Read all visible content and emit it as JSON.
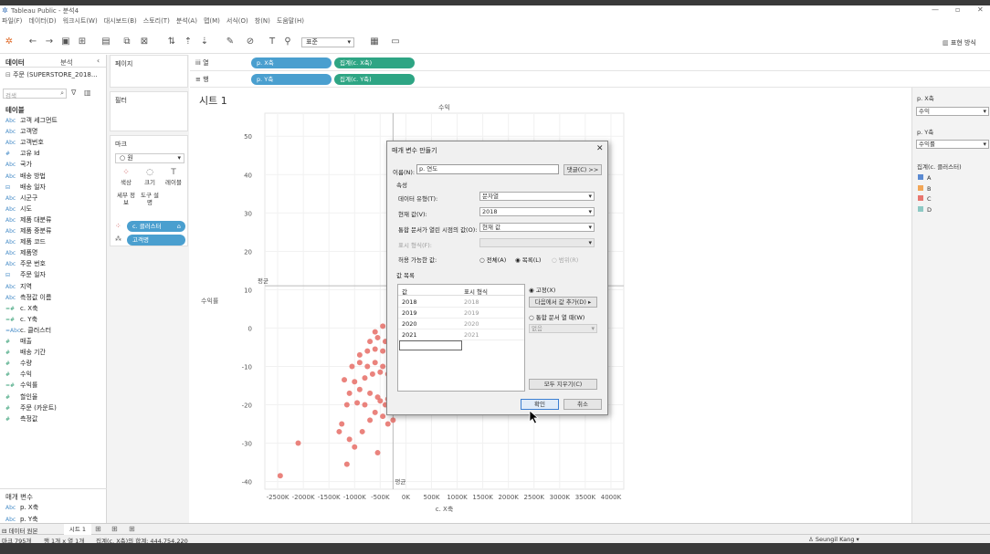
{
  "window": {
    "title": "Tableau Public - 분석4"
  },
  "menu": [
    "파일(F)",
    "데이터(D)",
    "워크시트(W)",
    "대시보드(B)",
    "스토리(T)",
    "분석(A)",
    "맵(M)",
    "서식(O)",
    "창(N)",
    "도움말(H)"
  ],
  "toolbar": {
    "fit_select": "표준",
    "show_me": "표현 방식"
  },
  "data_pane": {
    "tab_data": "데이터",
    "tab_analysis": "분석",
    "datasource": "주문 (SUPERSTORE_2018...",
    "search_placeholder": "검색",
    "tables_header": "테이블",
    "fields": [
      {
        "type": "Abc",
        "name": "고객 세그먼트",
        "kind": "d"
      },
      {
        "type": "Abc",
        "name": "고객명",
        "kind": "d"
      },
      {
        "type": "Abc",
        "name": "고객번호",
        "kind": "d"
      },
      {
        "type": "#",
        "name": "고유 Id",
        "kind": "d"
      },
      {
        "type": "Abc",
        "name": "국가",
        "kind": "d"
      },
      {
        "type": "Abc",
        "name": "배송 방법",
        "kind": "d"
      },
      {
        "type": "⊟",
        "name": "배송 일자",
        "kind": "d"
      },
      {
        "type": "Abc",
        "name": "시군구",
        "kind": "d"
      },
      {
        "type": "Abc",
        "name": "시도",
        "kind": "d"
      },
      {
        "type": "Abc",
        "name": "제품 대분류",
        "kind": "d"
      },
      {
        "type": "Abc",
        "name": "제품 중분류",
        "kind": "d"
      },
      {
        "type": "Abc",
        "name": "제품 코드",
        "kind": "d"
      },
      {
        "type": "Abc",
        "name": "제품명",
        "kind": "d"
      },
      {
        "type": "Abc",
        "name": "주문 번호",
        "kind": "d"
      },
      {
        "type": "⊟",
        "name": "주문 일자",
        "kind": "d"
      },
      {
        "type": "Abc",
        "name": "지역",
        "kind": "d"
      },
      {
        "type": "Abc",
        "name": "측정값 이름",
        "kind": "d"
      },
      {
        "type": "=#",
        "name": "c. X축",
        "kind": "g"
      },
      {
        "type": "=#",
        "name": "c. Y축",
        "kind": "g"
      },
      {
        "type": "=Abc",
        "name": "c. 클러스터",
        "kind": "d"
      },
      {
        "type": "#",
        "name": "매출",
        "kind": "g"
      },
      {
        "type": "#",
        "name": "배송 기간",
        "kind": "g"
      },
      {
        "type": "#",
        "name": "수량",
        "kind": "g"
      },
      {
        "type": "#",
        "name": "수익",
        "kind": "g"
      },
      {
        "type": "=#",
        "name": "수익률",
        "kind": "g"
      },
      {
        "type": "#",
        "name": "할인율",
        "kind": "g"
      },
      {
        "type": "#",
        "name": "주문 (카운트)",
        "kind": "g"
      },
      {
        "type": "#",
        "name": "측정값",
        "kind": "g"
      }
    ],
    "params_header": "매개 변수",
    "params": [
      {
        "type": "Abc",
        "name": "p. X축"
      },
      {
        "type": "Abc",
        "name": "p. Y축"
      }
    ]
  },
  "shelves": {
    "pages": "페이지",
    "filters": "필터",
    "marks": "마크",
    "mark_type": "원",
    "mark_buttons": [
      "색상",
      "크기",
      "레이블",
      "세부 정보",
      "도구 설명"
    ],
    "mark_pills": [
      "c. 클러스터",
      "고객명"
    ],
    "columns_label": "열",
    "rows_label": "행",
    "columns_pills": [
      "p. X축",
      "집계(c. X축)"
    ],
    "rows_pills": [
      "p. Y축",
      "집계(c. Y축)"
    ]
  },
  "sheet": {
    "title": "시트 1",
    "top_axis_title": "수익",
    "ylabel": "수익률",
    "xlabel": "c. X축",
    "avg_label_y": "평균",
    "avg_label_x": "평균"
  },
  "chart_data": {
    "type": "scatter",
    "xlabel": "c. X축",
    "ylabel": "수익률",
    "xlim": [
      -2750,
      4250
    ],
    "ylim": [
      -42,
      56
    ],
    "xticks": [
      "-2500K",
      "-2000K",
      "-1500K",
      "-1000K",
      "-500K",
      "0K",
      "500K",
      "1000K",
      "1500K",
      "2000K",
      "2500K",
      "3000K",
      "3500K",
      "4000K"
    ],
    "xtick_values": [
      -2500,
      -2000,
      -1500,
      -1000,
      -500,
      0,
      500,
      1000,
      1500,
      2000,
      2500,
      3000,
      3500,
      4000
    ],
    "yticks": [
      50,
      40,
      30,
      20,
      10,
      0,
      -10,
      -20,
      -30,
      -40
    ],
    "reference_lines": {
      "y_avg": 11,
      "x_avg": -250
    },
    "marker_color": "#e8766f",
    "points": [
      [
        -2450,
        -38.5
      ],
      [
        -2100,
        -30
      ],
      [
        -1150,
        -35.5
      ],
      [
        -1300,
        -27
      ],
      [
        -1100,
        -29
      ],
      [
        -1250,
        -25
      ],
      [
        -1000,
        -31
      ],
      [
        -850,
        -27
      ],
      [
        -550,
        -32.5
      ],
      [
        -700,
        -24
      ],
      [
        -600,
        -22
      ],
      [
        -450,
        -23
      ],
      [
        -350,
        -25
      ],
      [
        -250,
        -24
      ],
      [
        -400,
        -20
      ],
      [
        -500,
        -19
      ],
      [
        -800,
        -20
      ],
      [
        -950,
        -19.5
      ],
      [
        -1150,
        -20
      ],
      [
        -1100,
        -17
      ],
      [
        -900,
        -16
      ],
      [
        -700,
        -17
      ],
      [
        -550,
        -18
      ],
      [
        -350,
        -18.5
      ],
      [
        -1200,
        -13.5
      ],
      [
        -1000,
        -14
      ],
      [
        -800,
        -13
      ],
      [
        -650,
        -12
      ],
      [
        -500,
        -11.5
      ],
      [
        -350,
        -12
      ],
      [
        -1050,
        -10
      ],
      [
        -900,
        -9
      ],
      [
        -750,
        -10
      ],
      [
        -600,
        -9
      ],
      [
        -450,
        -10
      ],
      [
        -300,
        -11
      ],
      [
        -900,
        -7
      ],
      [
        -750,
        -6
      ],
      [
        -600,
        -5.5
      ],
      [
        -450,
        -6
      ],
      [
        -300,
        -7.5
      ],
      [
        -700,
        -3.5
      ],
      [
        -550,
        -2.5
      ],
      [
        -400,
        -3.5
      ],
      [
        -600,
        -1
      ],
      [
        -450,
        0.5
      ],
      [
        -300,
        -1
      ]
    ]
  },
  "right_panel": {
    "p_x_label": "p. X축",
    "p_x_value": "수익",
    "p_y_label": "p. Y축",
    "p_y_value": "수익률",
    "legend_title": "집계(c. 클러스터)",
    "legend": [
      {
        "label": "A",
        "color": "#5b8ad1"
      },
      {
        "label": "B",
        "color": "#f2a657"
      },
      {
        "label": "C",
        "color": "#e8766f"
      },
      {
        "label": "D",
        "color": "#8dc9c4"
      }
    ]
  },
  "dialog": {
    "title": "매개 변수 만들기",
    "name_label": "이름(N):",
    "name_value": "p. 연도",
    "comment_button": "댓글(C) >>",
    "props_header": "속성",
    "datatype_label": "데이터 유형(T):",
    "datatype_value": "문자열",
    "current_label": "현재 값(V):",
    "current_value": "2018",
    "workbook_label": "통합 문서가 열린 시점의 값(O):",
    "workbook_value": "현재 값",
    "display_label": "표시 형식(F):",
    "allowed_label": "허용 가능한 값:",
    "allowed_options": [
      "전체(A)",
      "목록(L)",
      "범위(R)"
    ],
    "list_header": "값 목록",
    "col_value": "값",
    "col_display": "표시 형식",
    "rows": [
      {
        "value": "2018",
        "display": "2018"
      },
      {
        "value": "2019",
        "display": "2019"
      },
      {
        "value": "2020",
        "display": "2020"
      },
      {
        "value": "2021",
        "display": "2021"
      }
    ],
    "fixed_option": "고정(X)",
    "add_from": "다음에서 값 추가(D)",
    "on_open_option": "통합 문서 열 때(W)",
    "none_select": "없음",
    "clear_all": "모두 지우기(C)",
    "ok": "확인",
    "cancel": "취소"
  },
  "status": {
    "datasource_tab": "데이터 원본",
    "sheet_tab": "시트 1",
    "marks": "마크 795개",
    "rows_cols": "행 1개 x 열 1개",
    "sum": "집계(c. X축)의 합계: 444,754,220",
    "user": "Seungil Kang"
  }
}
